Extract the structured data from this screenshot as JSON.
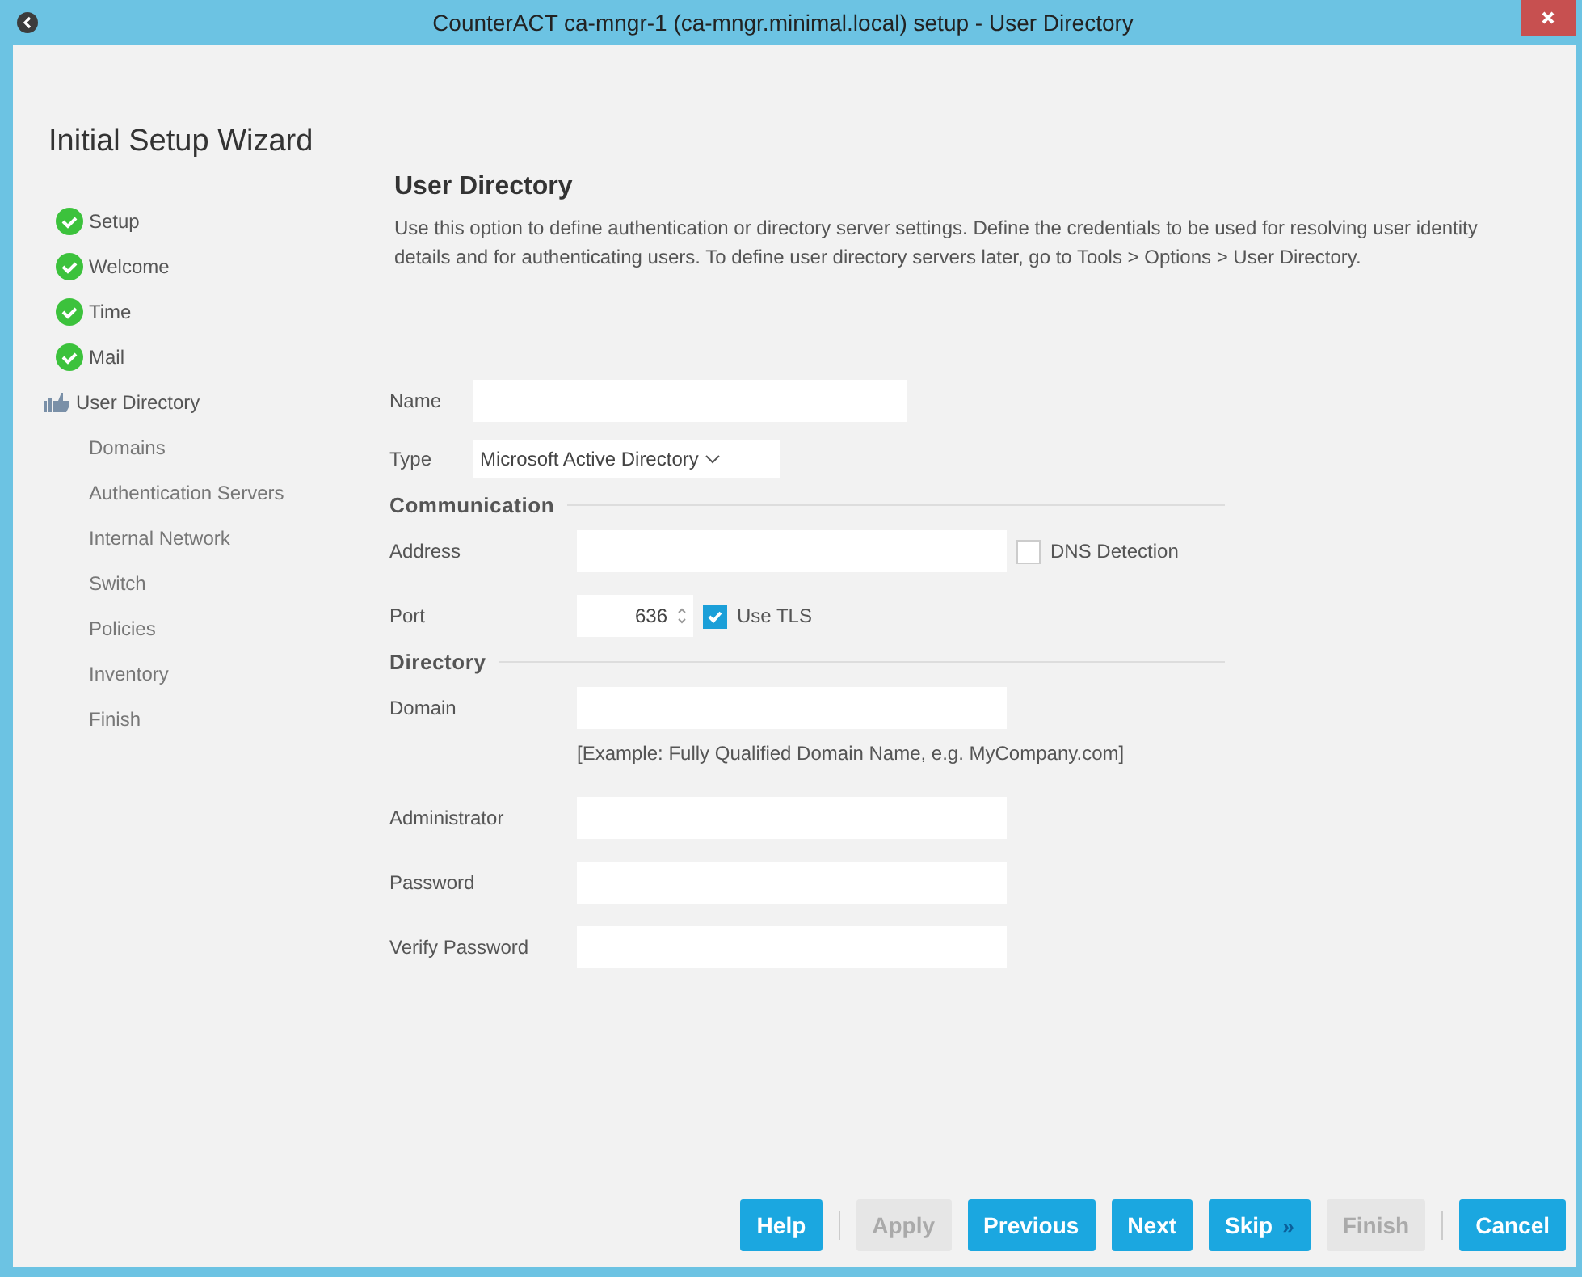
{
  "window": {
    "title": "CounterACT ca-mngr-1 (ca-mngr.minimal.local) setup - User Directory"
  },
  "wizard_title": "Initial Setup Wizard",
  "steps": [
    {
      "label": "Setup",
      "kind": "done"
    },
    {
      "label": "Welcome",
      "kind": "done"
    },
    {
      "label": "Time",
      "kind": "done"
    },
    {
      "label": "Mail",
      "kind": "done"
    },
    {
      "label": "User Directory",
      "kind": "current"
    },
    {
      "label": "Domains",
      "kind": "pending"
    },
    {
      "label": "Authentication Servers",
      "kind": "pending"
    },
    {
      "label": "Internal Network",
      "kind": "pending"
    },
    {
      "label": "Switch",
      "kind": "pending"
    },
    {
      "label": "Policies",
      "kind": "pending"
    },
    {
      "label": "Inventory",
      "kind": "pending"
    },
    {
      "label": "Finish",
      "kind": "pending"
    }
  ],
  "page": {
    "title": "User Directory",
    "description": "Use this option to define authentication or directory server settings. Define the credentials to be used for resolving user identity details and for authenticating users. To define user directory servers later, go to Tools > Options > User Directory."
  },
  "name_field": {
    "label": "Name"
  },
  "type_field": {
    "label": "Type",
    "value": "Microsoft Active Directory"
  },
  "sections": [
    {
      "title": "Communication",
      "rows": [
        {
          "kind": "text",
          "label": "Address",
          "checkbox": {
            "label": "DNS Detection",
            "checked": false
          }
        },
        {
          "kind": "spinner",
          "label": "Port",
          "value": "636",
          "checkbox": {
            "label": "Use TLS",
            "checked": true
          }
        }
      ]
    },
    {
      "title": "Directory",
      "rows": [
        {
          "kind": "text",
          "label": "Domain"
        },
        {
          "kind": "hint",
          "text": "[Example: Fully Qualified Domain Name, e.g. MyCompany.com]"
        },
        {
          "kind": "text",
          "label": "Administrator"
        },
        {
          "kind": "text",
          "label": "Password"
        },
        {
          "kind": "text",
          "label": "Verify Password"
        }
      ]
    }
  ],
  "buttons": [
    {
      "kind": "button",
      "label": "Help",
      "disabled": false
    },
    {
      "kind": "separator"
    },
    {
      "kind": "button",
      "label": "Apply",
      "disabled": true
    },
    {
      "kind": "button",
      "label": "Previous",
      "disabled": false
    },
    {
      "kind": "button",
      "label": "Next",
      "disabled": false
    },
    {
      "kind": "button",
      "label": "Skip",
      "disabled": false,
      "chevrons": "»"
    },
    {
      "kind": "button",
      "label": "Finish",
      "disabled": true
    },
    {
      "kind": "separator"
    },
    {
      "kind": "button",
      "label": "Cancel",
      "disabled": false
    }
  ]
}
